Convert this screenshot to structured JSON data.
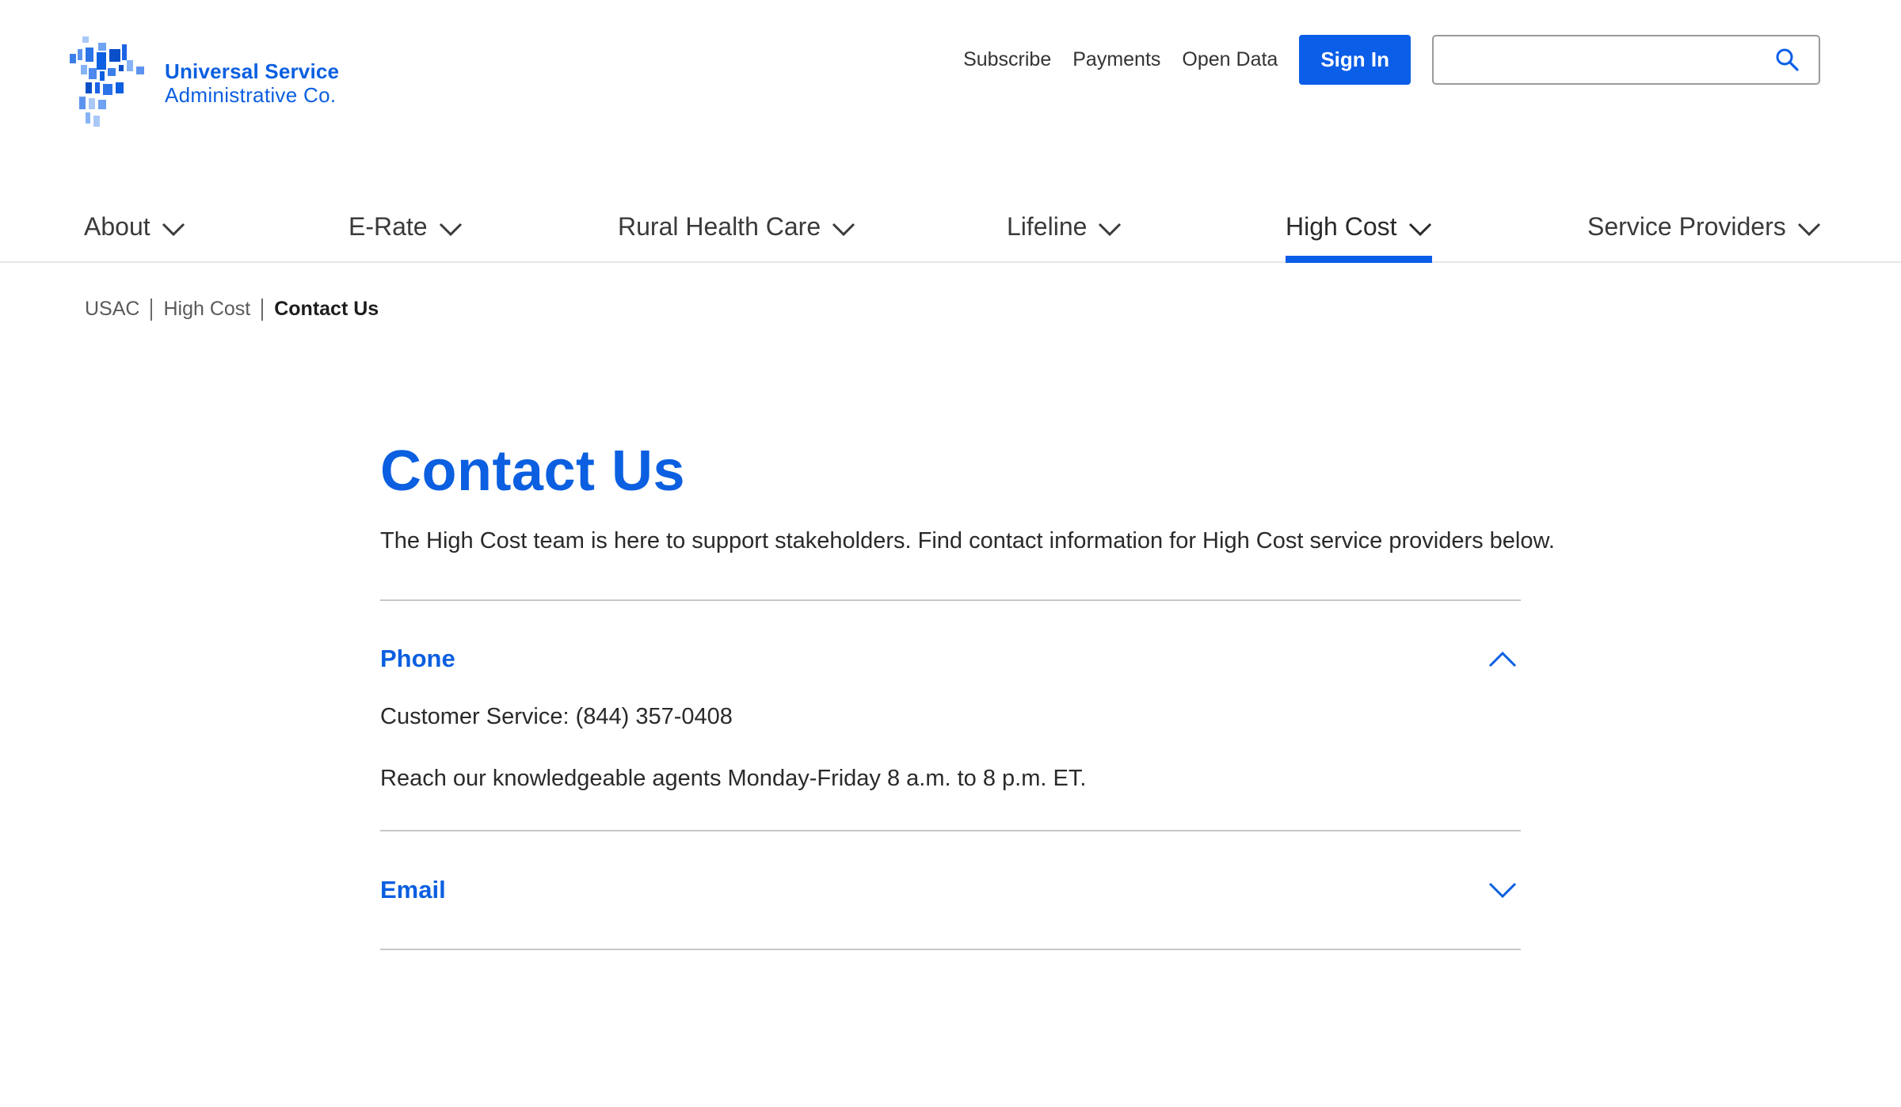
{
  "logo": {
    "line1": "Universal Service",
    "line2": "Administrative Co."
  },
  "utility_nav": {
    "links": [
      "Subscribe",
      "Payments",
      "Open Data"
    ],
    "sign_in": "Sign In",
    "search_placeholder": ""
  },
  "main_nav": {
    "items": [
      {
        "label": "About"
      },
      {
        "label": "E-Rate"
      },
      {
        "label": "Rural Health Care"
      },
      {
        "label": "Lifeline"
      },
      {
        "label": "High Cost",
        "active": true
      },
      {
        "label": "Service Providers"
      }
    ]
  },
  "breadcrumb": [
    "USAC",
    "High Cost",
    "Contact Us"
  ],
  "main": {
    "title": "Contact Us",
    "intro": "The High Cost team is here to support stakeholders. Find contact information for High Cost service providers below.",
    "accordion": [
      {
        "title": "Phone",
        "expanded": true,
        "body": [
          "Customer Service: (844) 357-0408",
          "Reach our knowledgeable agents Monday-Friday 8 a.m. to 8 p.m. ET."
        ]
      },
      {
        "title": "Email",
        "expanded": false
      }
    ]
  },
  "colors": {
    "brand_blue": "#0b5fe0",
    "button_blue": "#0a5ee8",
    "text": "#2a2a2a"
  },
  "icons": {
    "search": "search-icon",
    "nav_chevron": "chevron-down-icon",
    "accordion_open": "chevron-up-icon",
    "accordion_closed": "chevron-down-icon"
  }
}
